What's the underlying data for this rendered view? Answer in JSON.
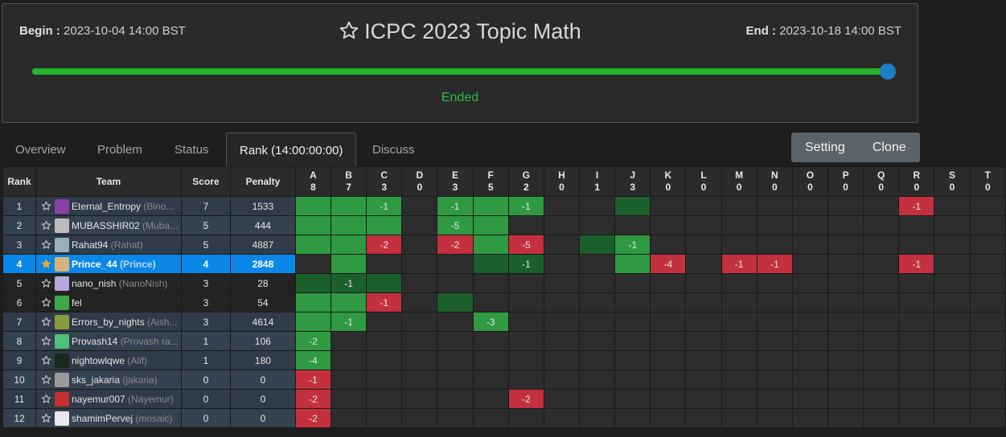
{
  "contest": {
    "begin_label": "Begin :",
    "begin_value": "2023-10-04 14:00 BST",
    "end_label": "End :",
    "end_value": "2023-10-18 14:00 BST",
    "title": "ICPC 2023 Topic Math",
    "progress_percent": 100,
    "status": "Ended"
  },
  "tabs": [
    {
      "label": "Overview",
      "active": false
    },
    {
      "label": "Problem",
      "active": false
    },
    {
      "label": "Status",
      "active": false
    },
    {
      "label": "Rank (14:00:00:00)",
      "active": true
    },
    {
      "label": "Discuss",
      "active": false
    }
  ],
  "buttons": {
    "setting": "Setting",
    "clone": "Clone"
  },
  "colors": {
    "accepted": "#2f9a41",
    "first_blood": "#1b5f2d",
    "wrong": "#c4303d",
    "highlight_row": "#0b87e8",
    "progress": "#22b52a",
    "knob": "#1d7fc8"
  },
  "table": {
    "headers": {
      "rank": "Rank",
      "team": "Team",
      "score": "Score",
      "penalty": "Penalty"
    },
    "problems": [
      {
        "letter": "A",
        "count": "8",
        "hl": ""
      },
      {
        "letter": "B",
        "count": "7",
        "hl": "green"
      },
      {
        "letter": "C",
        "count": "3",
        "hl": ""
      },
      {
        "letter": "D",
        "count": "0",
        "hl": ""
      },
      {
        "letter": "E",
        "count": "3",
        "hl": ""
      },
      {
        "letter": "F",
        "count": "5",
        "hl": "green"
      },
      {
        "letter": "G",
        "count": "2",
        "hl": "green"
      },
      {
        "letter": "H",
        "count": "0",
        "hl": ""
      },
      {
        "letter": "I",
        "count": "1",
        "hl": ""
      },
      {
        "letter": "J",
        "count": "3",
        "hl": "green"
      },
      {
        "letter": "K",
        "count": "0",
        "hl": "red"
      },
      {
        "letter": "L",
        "count": "0",
        "hl": ""
      },
      {
        "letter": "M",
        "count": "0",
        "hl": "red"
      },
      {
        "letter": "N",
        "count": "0",
        "hl": "red"
      },
      {
        "letter": "O",
        "count": "0",
        "hl": ""
      },
      {
        "letter": "P",
        "count": "0",
        "hl": ""
      },
      {
        "letter": "Q",
        "count": "0",
        "hl": ""
      },
      {
        "letter": "R",
        "count": "0",
        "hl": "red"
      },
      {
        "letter": "S",
        "count": "0",
        "hl": ""
      },
      {
        "letter": "T",
        "count": "0",
        "hl": ""
      }
    ],
    "rows": [
      {
        "rank": "1",
        "user": "Eternal_Entropy",
        "nick": "(Bino...",
        "score": "7",
        "penalty": "1533",
        "me": false,
        "avatar": "#8a3fa8",
        "cells": [
          [
            "ac",
            ""
          ],
          [
            "ac",
            ""
          ],
          [
            "ac",
            "-1"
          ],
          [
            "",
            ""
          ],
          [
            "ac",
            "-1"
          ],
          [
            "ac",
            ""
          ],
          [
            "ac",
            "-1"
          ],
          [
            "",
            ""
          ],
          [
            "",
            ""
          ],
          [
            "fb",
            ""
          ],
          [
            "",
            ""
          ],
          [
            "",
            ""
          ],
          [
            "",
            ""
          ],
          [
            "",
            ""
          ],
          [
            "",
            ""
          ],
          [
            "",
            ""
          ],
          [
            "",
            ""
          ],
          [
            "wa",
            "-1"
          ],
          [
            "",
            ""
          ],
          [
            "",
            ""
          ]
        ]
      },
      {
        "rank": "2",
        "user": "MUBASSHIR02",
        "nick": "(Muba...",
        "score": "5",
        "penalty": "444",
        "me": false,
        "avatar": "#bdbdbd",
        "cells": [
          [
            "ac",
            ""
          ],
          [
            "ac",
            ""
          ],
          [
            "ac",
            ""
          ],
          [
            "",
            ""
          ],
          [
            "ac",
            "-5"
          ],
          [
            "ac",
            ""
          ],
          [
            "",
            ""
          ],
          [
            "",
            ""
          ],
          [
            "",
            ""
          ],
          [
            "",
            ""
          ],
          [
            "",
            ""
          ],
          [
            "",
            ""
          ],
          [
            "",
            ""
          ],
          [
            "",
            ""
          ],
          [
            "",
            ""
          ],
          [
            "",
            ""
          ],
          [
            "",
            ""
          ],
          [
            "",
            ""
          ],
          [
            "",
            ""
          ],
          [
            "",
            ""
          ]
        ]
      },
      {
        "rank": "3",
        "user": "Rahat94",
        "nick": "(Rahat)",
        "score": "5",
        "penalty": "4887",
        "me": false,
        "avatar": "#9ab0b8",
        "cells": [
          [
            "ac",
            ""
          ],
          [
            "ac",
            ""
          ],
          [
            "wa",
            "-2"
          ],
          [
            "",
            ""
          ],
          [
            "wa",
            "-2"
          ],
          [
            "ac",
            ""
          ],
          [
            "wa",
            "-5"
          ],
          [
            "",
            ""
          ],
          [
            "fb",
            ""
          ],
          [
            "ac",
            "-1"
          ],
          [
            "",
            ""
          ],
          [
            "",
            ""
          ],
          [
            "",
            ""
          ],
          [
            "",
            ""
          ],
          [
            "",
            ""
          ],
          [
            "",
            ""
          ],
          [
            "",
            ""
          ],
          [
            "",
            ""
          ],
          [
            "",
            ""
          ],
          [
            "",
            ""
          ]
        ]
      },
      {
        "rank": "4",
        "user": "Prince_44",
        "nick": "(Prince)",
        "score": "4",
        "penalty": "2848",
        "me": true,
        "avatar": "#d9b27a",
        "cells": [
          [
            "",
            ""
          ],
          [
            "ac",
            ""
          ],
          [
            "",
            ""
          ],
          [
            "",
            ""
          ],
          [
            "",
            ""
          ],
          [
            "fb",
            ""
          ],
          [
            "fb",
            "-1"
          ],
          [
            "",
            ""
          ],
          [
            "",
            ""
          ],
          [
            "ac",
            ""
          ],
          [
            "wa",
            "-4"
          ],
          [
            "",
            ""
          ],
          [
            "wa",
            "-1"
          ],
          [
            "wa",
            "-1"
          ],
          [
            "",
            ""
          ],
          [
            "",
            ""
          ],
          [
            "",
            ""
          ],
          [
            "wa",
            "-1"
          ],
          [
            "",
            ""
          ],
          [
            "",
            ""
          ]
        ]
      },
      {
        "rank": "5",
        "user": "nano_nish",
        "nick": "(NanoNish)",
        "score": "3",
        "penalty": "28",
        "me": false,
        "avatar": "#b7a6e0",
        "cells": [
          [
            "fb",
            ""
          ],
          [
            "fb",
            "-1"
          ],
          [
            "fb",
            ""
          ],
          [
            "",
            ""
          ],
          [
            "",
            ""
          ],
          [
            "",
            ""
          ],
          [
            "",
            ""
          ],
          [
            "",
            ""
          ],
          [
            "",
            ""
          ],
          [
            "",
            ""
          ],
          [
            "",
            ""
          ],
          [
            "",
            ""
          ],
          [
            "",
            ""
          ],
          [
            "",
            ""
          ],
          [
            "",
            ""
          ],
          [
            "",
            ""
          ],
          [
            "",
            ""
          ],
          [
            "",
            ""
          ],
          [
            "",
            ""
          ],
          [
            "",
            ""
          ]
        ]
      },
      {
        "rank": "6",
        "user": "fel",
        "nick": "",
        "score": "3",
        "penalty": "54",
        "me": false,
        "avatar": "#3fa84a",
        "cells": [
          [
            "ac",
            ""
          ],
          [
            "ac",
            ""
          ],
          [
            "wa",
            "-1"
          ],
          [
            "",
            ""
          ],
          [
            "fb",
            ""
          ],
          [
            "",
            ""
          ],
          [
            "",
            ""
          ],
          [
            "",
            ""
          ],
          [
            "",
            ""
          ],
          [
            "",
            ""
          ],
          [
            "",
            ""
          ],
          [
            "",
            ""
          ],
          [
            "",
            ""
          ],
          [
            "",
            ""
          ],
          [
            "",
            ""
          ],
          [
            "",
            ""
          ],
          [
            "",
            ""
          ],
          [
            "",
            ""
          ],
          [
            "",
            ""
          ],
          [
            "",
            ""
          ]
        ]
      },
      {
        "rank": "7",
        "user": "Errors_by_nights",
        "nick": "(Aish...",
        "score": "3",
        "penalty": "4614",
        "me": false,
        "avatar": "#8a9a3f",
        "cells": [
          [
            "ac",
            ""
          ],
          [
            "ac",
            "-1"
          ],
          [
            "",
            ""
          ],
          [
            "",
            ""
          ],
          [
            "",
            ""
          ],
          [
            "ac",
            "-3"
          ],
          [
            "",
            ""
          ],
          [
            "",
            ""
          ],
          [
            "",
            ""
          ],
          [
            "",
            ""
          ],
          [
            "",
            ""
          ],
          [
            "",
            ""
          ],
          [
            "",
            ""
          ],
          [
            "",
            ""
          ],
          [
            "",
            ""
          ],
          [
            "",
            ""
          ],
          [
            "",
            ""
          ],
          [
            "",
            ""
          ],
          [
            "",
            ""
          ],
          [
            "",
            ""
          ]
        ]
      },
      {
        "rank": "8",
        "user": "Provash14",
        "nick": "(Provash ra...",
        "score": "1",
        "penalty": "106",
        "me": false,
        "avatar": "#4fbf7a",
        "cells": [
          [
            "ac",
            "-2"
          ],
          [
            "",
            ""
          ],
          [
            "",
            ""
          ],
          [
            "",
            ""
          ],
          [
            "",
            ""
          ],
          [
            "",
            ""
          ],
          [
            "",
            ""
          ],
          [
            "",
            ""
          ],
          [
            "",
            ""
          ],
          [
            "",
            ""
          ],
          [
            "",
            ""
          ],
          [
            "",
            ""
          ],
          [
            "",
            ""
          ],
          [
            "",
            ""
          ],
          [
            "",
            ""
          ],
          [
            "",
            ""
          ],
          [
            "",
            ""
          ],
          [
            "",
            ""
          ],
          [
            "",
            ""
          ],
          [
            "",
            ""
          ]
        ]
      },
      {
        "rank": "9",
        "user": "nightowlqwe",
        "nick": "(Alif)",
        "score": "1",
        "penalty": "180",
        "me": false,
        "avatar": "#1a2a1a",
        "cells": [
          [
            "ac",
            "-4"
          ],
          [
            "",
            ""
          ],
          [
            "",
            ""
          ],
          [
            "",
            ""
          ],
          [
            "",
            ""
          ],
          [
            "",
            ""
          ],
          [
            "",
            ""
          ],
          [
            "",
            ""
          ],
          [
            "",
            ""
          ],
          [
            "",
            ""
          ],
          [
            "",
            ""
          ],
          [
            "",
            ""
          ],
          [
            "",
            ""
          ],
          [
            "",
            ""
          ],
          [
            "",
            ""
          ],
          [
            "",
            ""
          ],
          [
            "",
            ""
          ],
          [
            "",
            ""
          ],
          [
            "",
            ""
          ],
          [
            "",
            ""
          ]
        ]
      },
      {
        "rank": "10",
        "user": "sks_jakaria",
        "nick": "(jakaria)",
        "score": "0",
        "penalty": "0",
        "me": false,
        "avatar": "#9a9a9a",
        "cells": [
          [
            "wa",
            "-1"
          ],
          [
            "",
            ""
          ],
          [
            "",
            ""
          ],
          [
            "",
            ""
          ],
          [
            "",
            ""
          ],
          [
            "",
            ""
          ],
          [
            "",
            ""
          ],
          [
            "",
            ""
          ],
          [
            "",
            ""
          ],
          [
            "",
            ""
          ],
          [
            "",
            ""
          ],
          [
            "",
            ""
          ],
          [
            "",
            ""
          ],
          [
            "",
            ""
          ],
          [
            "",
            ""
          ],
          [
            "",
            ""
          ],
          [
            "",
            ""
          ],
          [
            "",
            ""
          ],
          [
            "",
            ""
          ],
          [
            "",
            ""
          ]
        ]
      },
      {
        "rank": "11",
        "user": "nayemur007",
        "nick": "(Nayemur)",
        "score": "0",
        "penalty": "0",
        "me": false,
        "avatar": "#c43030",
        "cells": [
          [
            "wa",
            "-2"
          ],
          [
            "",
            ""
          ],
          [
            "",
            ""
          ],
          [
            "",
            ""
          ],
          [
            "",
            ""
          ],
          [
            "",
            ""
          ],
          [
            "wa",
            "-2"
          ],
          [
            "",
            ""
          ],
          [
            "",
            ""
          ],
          [
            "",
            ""
          ],
          [
            "",
            ""
          ],
          [
            "",
            ""
          ],
          [
            "",
            ""
          ],
          [
            "",
            ""
          ],
          [
            "",
            ""
          ],
          [
            "",
            ""
          ],
          [
            "",
            ""
          ],
          [
            "",
            ""
          ],
          [
            "",
            ""
          ],
          [
            "",
            ""
          ]
        ]
      },
      {
        "rank": "12",
        "user": "shamimPervej",
        "nick": "(mosaic)",
        "score": "0",
        "penalty": "0",
        "me": false,
        "avatar": "#e8e8e8",
        "cells": [
          [
            "wa",
            "-2"
          ],
          [
            "",
            ""
          ],
          [
            "",
            ""
          ],
          [
            "",
            ""
          ],
          [
            "",
            ""
          ],
          [
            "",
            ""
          ],
          [
            "",
            ""
          ],
          [
            "",
            ""
          ],
          [
            "",
            ""
          ],
          [
            "",
            ""
          ],
          [
            "",
            ""
          ],
          [
            "",
            ""
          ],
          [
            "",
            ""
          ],
          [
            "",
            ""
          ],
          [
            "",
            ""
          ],
          [
            "",
            ""
          ],
          [
            "",
            ""
          ],
          [
            "",
            ""
          ],
          [
            "",
            ""
          ],
          [
            "",
            ""
          ]
        ]
      }
    ]
  }
}
